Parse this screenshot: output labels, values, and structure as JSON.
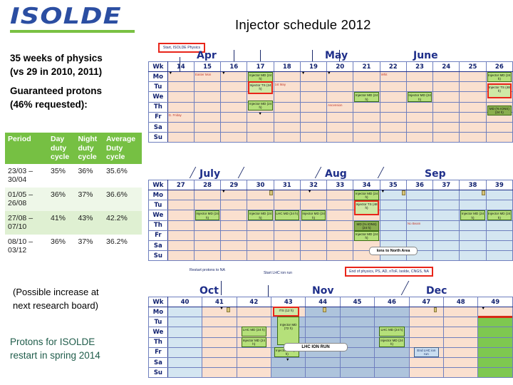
{
  "logo": {
    "text": "ISOLDE",
    "color": "#2b4ea2",
    "bar_color": "#7ac143"
  },
  "title": "Injector schedule 2012",
  "left": {
    "weeks_line1": "35 weeks of physics",
    "weeks_line2": "(vs 29 in 2010, 2011)",
    "protons_line1": "Guaranteed protons",
    "protons_line2": "(46% requested):",
    "increase_line1": "(Possible increase at",
    "increase_line2": "next research board)",
    "restart_line1": "Protons for ISOLDE",
    "restart_line2": "restart in spring 2014"
  },
  "duty_table": {
    "headers": [
      "Period",
      "Day duty cycle",
      "Night duty cycle",
      "Average Duty cycle"
    ],
    "header_color": "#76c043",
    "rows": [
      {
        "period": "23/03 – 30/04",
        "day": "35%",
        "night": "36%",
        "avg": "35.6%"
      },
      {
        "period": "01/05 – 26/08",
        "day": "36%",
        "night": "37%",
        "avg": "36.6%"
      },
      {
        "period": "27/08 – 07/10",
        "day": "41%",
        "night": "43%",
        "avg": "42.2%"
      },
      {
        "period": "08/10 – 03/12",
        "day": "36%",
        "night": "37%",
        "avg": "36.2%"
      }
    ]
  },
  "schedule": {
    "day_labels": [
      "Mo",
      "Tu",
      "We",
      "Th",
      "Fr",
      "Sa",
      "Su"
    ],
    "wk_label": "Wk",
    "blocks": [
      {
        "id": "block-apr-jun",
        "months": [
          "Apr",
          "May",
          "June"
        ],
        "weeks": [
          "14",
          "15",
          "16",
          "17",
          "18",
          "19",
          "20",
          "21",
          "22",
          "23",
          "24",
          "25",
          "26"
        ],
        "notes": [
          {
            "text": "Start, ISOLDE Physics",
            "style": "red"
          }
        ],
        "holidays": [
          "Easter Mon",
          "G. Friday",
          "1st May",
          "Ascension",
          "Whit"
        ],
        "events": [
          "Injector MD (24 h)",
          "Injector TS (24 h)",
          "Injector MD (24 h)",
          "Injector MD (24 h)",
          "Injector MD (24 h)",
          "Injector MD (24 h)",
          "Injector TS (48 h)",
          "MD (% IONS) (24 h)"
        ]
      },
      {
        "id": "block-jul-sep",
        "months": [
          "July",
          "Aug",
          "Sep"
        ],
        "weeks": [
          "27",
          "28",
          "29",
          "30",
          "31",
          "32",
          "33",
          "34",
          "35",
          "36",
          "37",
          "38",
          "39"
        ],
        "notes": [],
        "holidays": [
          "No Beam"
        ],
        "events": [
          "Injector MD (24 h)",
          "Injector MD (24 h)",
          "LHC MD (24 h)",
          "Injector MD (24 h)",
          "Injector MD (24 h)",
          "Injector TS (48 h)",
          "MD (% IONS) (24 h)",
          "Injector MD (24 h)",
          "Injector MD (24 h)",
          "Injector MD (24 h)",
          "Ions to North Area"
        ]
      },
      {
        "id": "block-oct-dec",
        "months": [
          "Oct",
          "Nov",
          "Dec"
        ],
        "weeks": [
          "40",
          "41",
          "42",
          "43",
          "44",
          "45",
          "46",
          "47",
          "48",
          "49"
        ],
        "notes": [
          {
            "text": "Restart protons to NA",
            "style": "plain"
          },
          {
            "text": "Start LHC ion run",
            "style": "plain"
          },
          {
            "text": "End of physics, PS, AD, nToF, Isolde, CNGS, NA",
            "style": "red"
          }
        ],
        "holidays": [],
        "events": [
          "LHC MD (24 h)",
          "Injector MD (24 h)",
          "ITS (12 h)",
          "Injector MD (72 h)",
          "Injector MD (24 h)",
          "LHC MD (24 h)",
          "Injector MD (24 h)",
          "End LHC ion run",
          "LHC ION RUN"
        ]
      }
    ]
  }
}
